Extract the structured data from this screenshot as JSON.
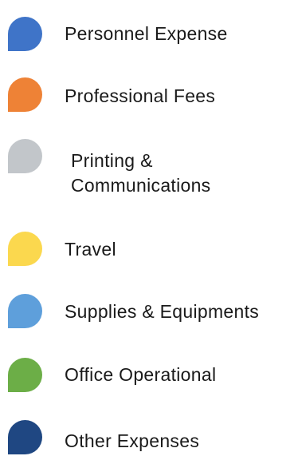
{
  "chart_data": {
    "type": "pie",
    "legend_entries": [
      {
        "label": "Personnel Expense",
        "color": "#3f74c8"
      },
      {
        "label": "Professional Fees",
        "color": "#ee8236"
      },
      {
        "label": "Printing & Communications",
        "color": "#c2c6ca"
      },
      {
        "label": "Travel",
        "color": "#fbd84e"
      },
      {
        "label": "Supplies & Equipments",
        "color": "#5e9fdb"
      },
      {
        "label": "Office Operational",
        "color": "#6cae47"
      },
      {
        "label": "Other Expenses",
        "color": "#1f4782"
      }
    ]
  }
}
